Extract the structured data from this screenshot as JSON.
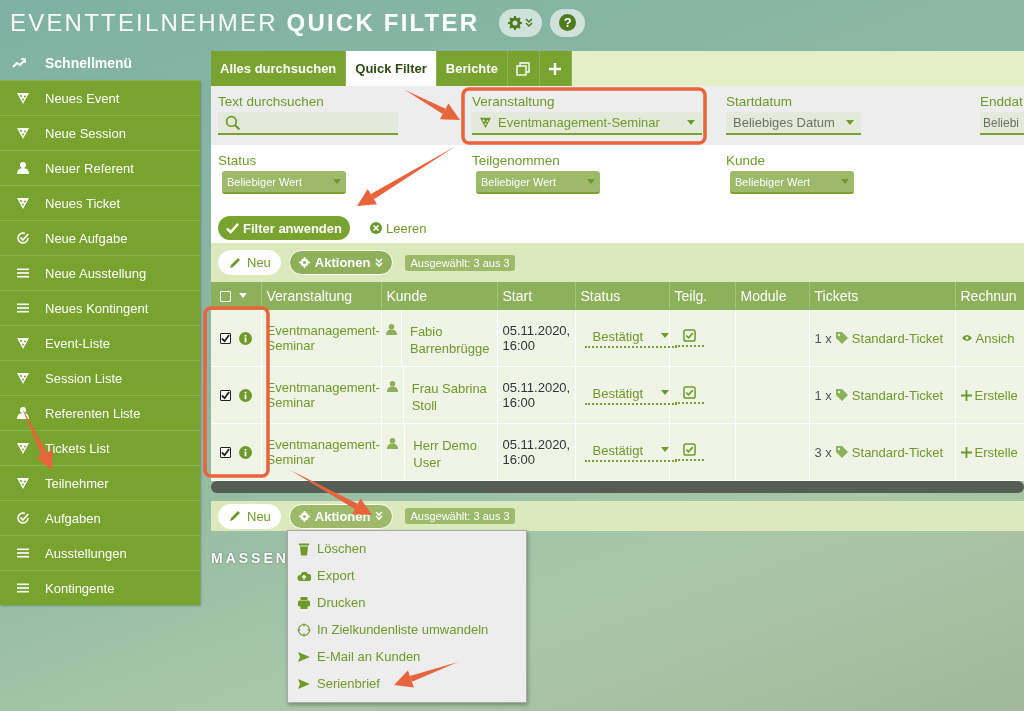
{
  "header": {
    "title_light": "EVENTTEILNEHMER",
    "title_bold": "QUICK FILTER",
    "help_button": "?"
  },
  "sidebar": {
    "heading": "Schnellmenü",
    "items": [
      {
        "label": "Neues Event",
        "kind": "event"
      },
      {
        "label": "Neue Session",
        "kind": "event"
      },
      {
        "label": "Neuer Referent",
        "kind": "person"
      },
      {
        "label": "Neues Ticket",
        "kind": "event"
      },
      {
        "label": "Neue Aufgabe",
        "kind": "task"
      },
      {
        "label": "Neue Ausstellung",
        "kind": "list"
      },
      {
        "label": "Neues Kontingent",
        "kind": "list"
      },
      {
        "label": "Event-Liste",
        "kind": "event"
      },
      {
        "label": "Session Liste",
        "kind": "event"
      },
      {
        "label": "Referenten Liste",
        "kind": "person"
      },
      {
        "label": "Tickets List",
        "kind": "event"
      },
      {
        "label": "Teilnehmer",
        "kind": "event"
      },
      {
        "label": "Aufgaben",
        "kind": "task"
      },
      {
        "label": "Ausstellungen",
        "kind": "list"
      },
      {
        "label": "Kontingente",
        "kind": "list"
      }
    ]
  },
  "tabs": [
    {
      "label": "Alles durchsuchen",
      "selected": false
    },
    {
      "label": "Quick Filter",
      "selected": true
    },
    {
      "label": "Berichte",
      "selected": false
    }
  ],
  "filters": [
    {
      "label": "Text durchsuchen",
      "kind": "search"
    },
    {
      "label": "Veranstaltung",
      "kind": "event-select",
      "value": "Eventmanagement-Seminar"
    },
    {
      "label": "Startdatum",
      "kind": "select",
      "placeholder": "Beliebiges Datum"
    },
    {
      "label": "Enddat",
      "kind": "select-cut",
      "placeholder": "Beliebi"
    },
    {
      "label": "Status",
      "kind": "select",
      "placeholder": "Beliebiger Wert"
    },
    {
      "label": "Teilgenommen",
      "kind": "select",
      "placeholder": "Beliebiger Wert"
    },
    {
      "label": "Kunde",
      "kind": "select",
      "placeholder": "Beliebiger Wert"
    }
  ],
  "filter_buttons": {
    "apply": "Filter anwenden",
    "clear": "Leeren"
  },
  "toolbar_top": {
    "new_button": "Neu",
    "actions_button": "Aktionen",
    "selection": "Ausgewählt: 3 aus 3"
  },
  "table": {
    "select_all_checked": false,
    "columns": [
      "Veranstaltung",
      "Kunde",
      "Start",
      "Status",
      "Teilg.",
      "Module",
      "Tickets",
      "Rechnun"
    ],
    "rows": [
      {
        "checked": true,
        "event": "Eventmanagement-Seminar",
        "customer": "Fabio Barrenbrügge",
        "start": "05.11.2020, 16:00",
        "status": "Bestätigt",
        "attended": true,
        "ticket_count": "1 x",
        "ticket": "Standard-Ticket",
        "invoice": {
          "label": "Ansich",
          "kind": "view"
        }
      },
      {
        "checked": true,
        "event": "Eventmanagement-Seminar",
        "customer": "Frau Sabrina Stoll",
        "start": "05.11.2020, 16:00",
        "status": "Bestätigt",
        "attended": true,
        "ticket_count": "1 x",
        "ticket": "Standard-Ticket",
        "invoice": {
          "label": "Erstelle",
          "kind": "create"
        }
      },
      {
        "checked": true,
        "event": "Eventmanagement-Seminar",
        "customer": "Herr Demo User",
        "start": "05.11.2020, 16:00",
        "status": "Bestätigt",
        "attended": true,
        "ticket_count": "3 x",
        "ticket": "Standard-Ticket",
        "invoice": {
          "label": "Erstelle",
          "kind": "create"
        }
      }
    ]
  },
  "toolbar_bottom": {
    "new_button": "Neu",
    "actions_button": "Aktionen",
    "selection": "Ausgewählt: 3 aus 3",
    "actions_menu": [
      {
        "label": "Löschen",
        "kind": "delete"
      },
      {
        "label": "Export",
        "kind": "export"
      },
      {
        "label": "Drucken",
        "kind": "print"
      },
      {
        "label": "In Zielkundenliste umwandeln",
        "kind": "target"
      },
      {
        "label": "E-Mail an Kunden",
        "kind": "send"
      },
      {
        "label": "Serienbrief",
        "kind": "send"
      }
    ]
  },
  "section_heading": "MASSEN"
}
